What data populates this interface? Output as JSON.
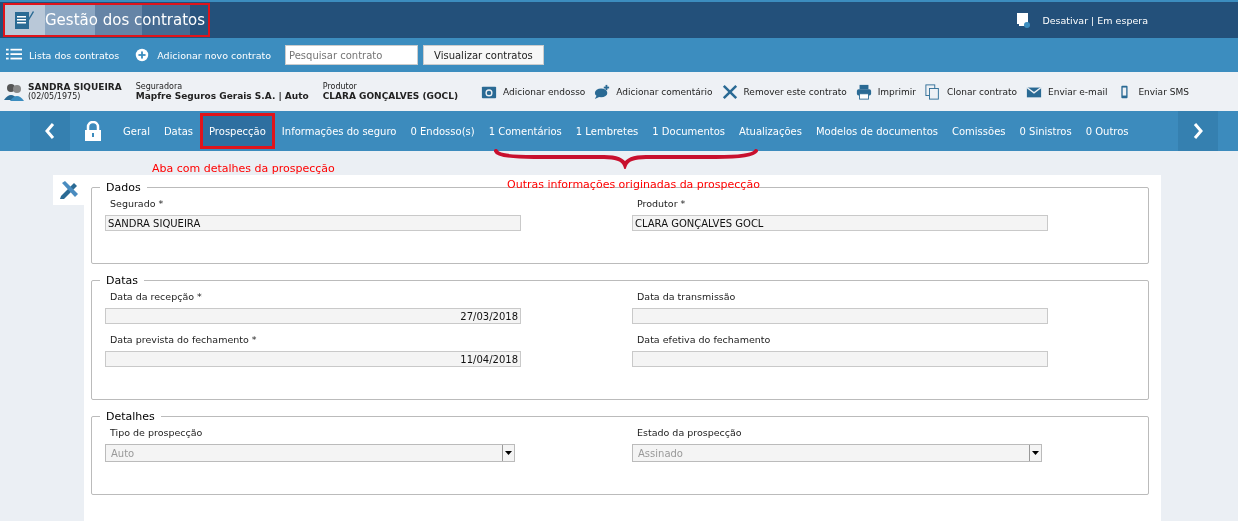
{
  "header": {
    "title": "Gestão dos contratos",
    "status": "Desativar | Em espera"
  },
  "toolbar": {
    "links": [
      {
        "label": "Lista dos contratos",
        "kind": "list"
      },
      {
        "label": "Adicionar novo contrato",
        "kind": "plus"
      }
    ],
    "search": {
      "placeholder": "Pesquisar contrato"
    },
    "button": "Visualizar contratos"
  },
  "client": {
    "name": "SANDRA SIQUEIRA",
    "birth": "(02/05/1975)",
    "insurer_label": "Seguradora",
    "insurer": "Mapfre Seguros Gerais S.A. | Auto",
    "producer_label": "Produtor",
    "producer": "CLARA GONÇALVES (GOCL)"
  },
  "actions": [
    {
      "label": "Adicionar endosso",
      "kind": "camera"
    },
    {
      "label": "Adicionar comentário",
      "kind": "comment"
    },
    {
      "label": "Remover este contrato",
      "kind": "cross"
    },
    {
      "label": "Imprimir",
      "kind": "printer"
    },
    {
      "label": "Clonar contrato",
      "kind": "copy"
    },
    {
      "label": "Enviar e-mail",
      "kind": "mail"
    },
    {
      "label": "Enviar SMS",
      "kind": "phone"
    }
  ],
  "tabs": [
    {
      "label": "Geral",
      "selected": false
    },
    {
      "label": "Datas",
      "selected": false
    },
    {
      "label": "Prospecção",
      "selected": true
    },
    {
      "label": "Informações do seguro",
      "selected": false
    },
    {
      "label": "0 Endosso(s)",
      "selected": false
    },
    {
      "label": "1 Comentários",
      "selected": false
    },
    {
      "label": "1 Lembretes",
      "selected": false
    },
    {
      "label": "1 Documentos",
      "selected": false
    },
    {
      "label": "Atualizações",
      "selected": false
    },
    {
      "label": "Modelos de documentos",
      "selected": false
    },
    {
      "label": "Comissões",
      "selected": false
    },
    {
      "label": "0 Sinistros",
      "selected": false
    },
    {
      "label": "0 Outros",
      "selected": false
    }
  ],
  "annotations": [
    "Aba com detalhes da prospecção",
    "Outras informações originadas da prospecção"
  ],
  "sections": [
    {
      "title": "Dados",
      "fields": [
        {
          "label": "Segurado *",
          "value": "SANDRA SIQUEIRA",
          "kind": "text"
        },
        {
          "label": "Produtor *",
          "value": "CLARA GONÇALVES GOCL",
          "kind": "text"
        }
      ]
    },
    {
      "title": "Datas",
      "fields": [
        {
          "label": "Data da recepção *",
          "value": "27/03/2018",
          "kind": "date"
        },
        {
          "label": "Data da transmissão",
          "kind": "date"
        },
        {
          "label": "Data prevista do fechamento *",
          "value": "11/04/2018",
          "kind": "date"
        },
        {
          "label": "Data efetiva do fechamento",
          "kind": "date"
        }
      ]
    },
    {
      "title": "Detalhes",
      "fields": [
        {
          "label": "Tipo de prospecção",
          "value": "Auto",
          "kind": "select",
          "disabled": true
        },
        {
          "label": "Estado da prospecção",
          "value": "Assinado",
          "kind": "select",
          "disabled": true
        }
      ]
    }
  ]
}
